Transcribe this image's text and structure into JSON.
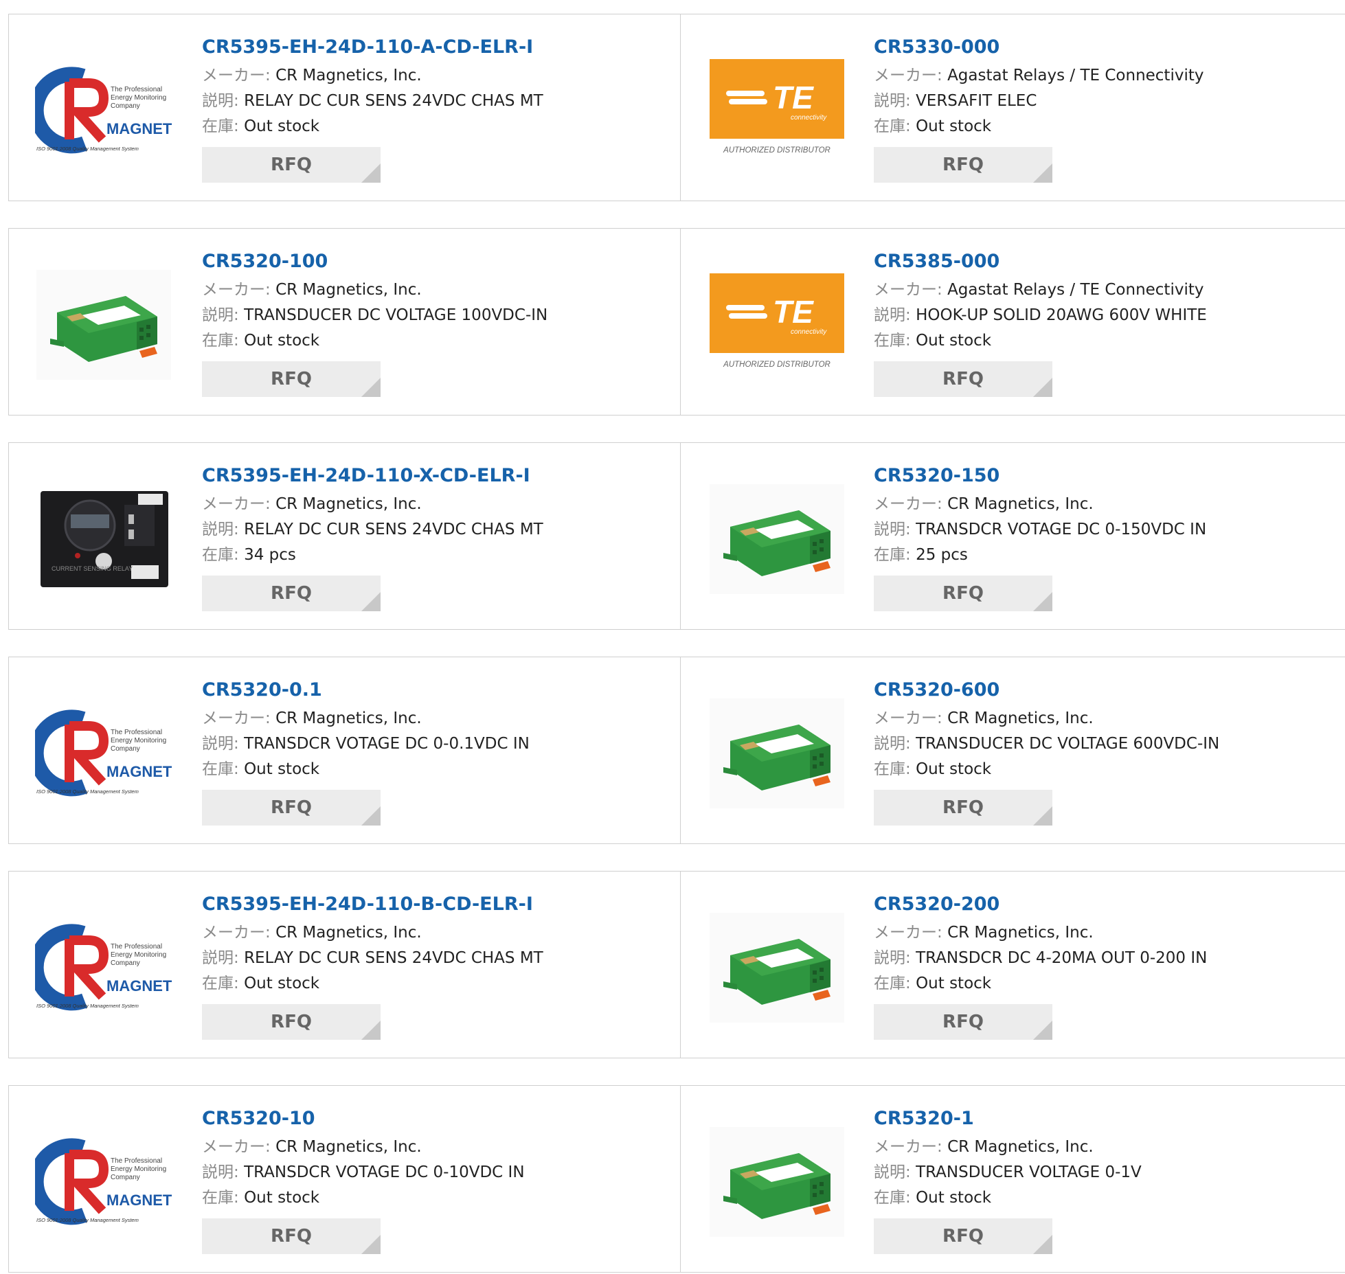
{
  "labels": {
    "maker": "メーカー:",
    "desc": "説明:",
    "stock": "在庫:",
    "rfq": "RFQ"
  },
  "logos": {
    "crm": {
      "line1": "The Professional",
      "line2": "Energy Monitoring",
      "line3": "Company",
      "brand": "MAGNETICS",
      "iso": "ISO 9001:2008 Quality Management System"
    },
    "te": {
      "text": "TE",
      "sub": "connectivity",
      "caption": "AUTHORIZED DISTRIBUTOR"
    },
    "relay_labels": {
      "side": "CURRENT SENSING RELAY"
    }
  },
  "products": [
    {
      "pn": "CR5395-EH-24D-110-A-CD-ELR-I",
      "maker": "CR Magnetics, Inc.",
      "desc": "RELAY DC CUR SENS 24VDC CHAS MT",
      "stock": "Out stock",
      "image": "crm-logo"
    },
    {
      "pn": "CR5330-000",
      "maker": "Agastat Relays / TE Connectivity",
      "desc": "VERSAFIT ELEC",
      "stock": "Out stock",
      "image": "te-logo"
    },
    {
      "pn": "CR5320-100",
      "maker": "CR Magnetics, Inc.",
      "desc": "TRANSDUCER DC VOLTAGE 100VDC-IN",
      "stock": "Out stock",
      "image": "green-module"
    },
    {
      "pn": "CR5385-000",
      "maker": "Agastat Relays / TE Connectivity",
      "desc": "HOOK-UP SOLID 20AWG 600V WHITE",
      "stock": "Out stock",
      "image": "te-logo"
    },
    {
      "pn": "CR5395-EH-24D-110-X-CD-ELR-I",
      "maker": "CR Magnetics, Inc.",
      "desc": "RELAY DC CUR SENS 24VDC CHAS MT",
      "stock": "34 pcs",
      "image": "black-relay"
    },
    {
      "pn": "CR5320-150",
      "maker": "CR Magnetics, Inc.",
      "desc": "TRANSDCR VOTAGE DC 0-150VDC IN",
      "stock": "25 pcs",
      "image": "green-module"
    },
    {
      "pn": "CR5320-0.1",
      "maker": "CR Magnetics, Inc.",
      "desc": "TRANSDCR VOTAGE DC 0-0.1VDC IN",
      "stock": "Out stock",
      "image": "crm-logo"
    },
    {
      "pn": "CR5320-600",
      "maker": "CR Magnetics, Inc.",
      "desc": "TRANSDUCER DC VOLTAGE 600VDC-IN",
      "stock": "Out stock",
      "image": "green-module"
    },
    {
      "pn": "CR5395-EH-24D-110-B-CD-ELR-I",
      "maker": "CR Magnetics, Inc.",
      "desc": "RELAY DC CUR SENS 24VDC CHAS MT",
      "stock": "Out stock",
      "image": "crm-logo"
    },
    {
      "pn": "CR5320-200",
      "maker": "CR Magnetics, Inc.",
      "desc": "TRANSDCR DC 4-20MA OUT 0-200 IN",
      "stock": "Out stock",
      "image": "green-module"
    },
    {
      "pn": "CR5320-10",
      "maker": "CR Magnetics, Inc.",
      "desc": "TRANSDCR VOTAGE DC 0-10VDC IN",
      "stock": "Out stock",
      "image": "crm-logo"
    },
    {
      "pn": "CR5320-1",
      "maker": "CR Magnetics, Inc.",
      "desc": "TRANSDUCER VOLTAGE 0-1V",
      "stock": "Out stock",
      "image": "green-module"
    }
  ],
  "colors": {
    "link": "#1662aa",
    "te_orange": "#f39a1e",
    "module_green": "#3da64a",
    "crm_blue": "#1e5aa8",
    "crm_red": "#d92b2b"
  }
}
